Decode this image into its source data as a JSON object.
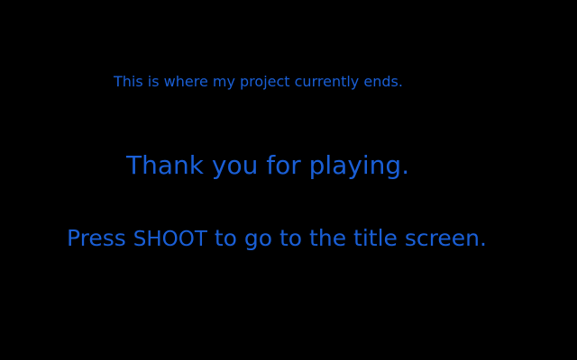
{
  "screen": {
    "note": "This is where my project currently ends.",
    "thanks": "Thank you for playing.",
    "prompt": {
      "before": "Press ",
      "key": "SHOOT",
      "after": " to go to the title screen."
    }
  },
  "colors": {
    "background": "#000000",
    "text": "#1a5fd6"
  }
}
